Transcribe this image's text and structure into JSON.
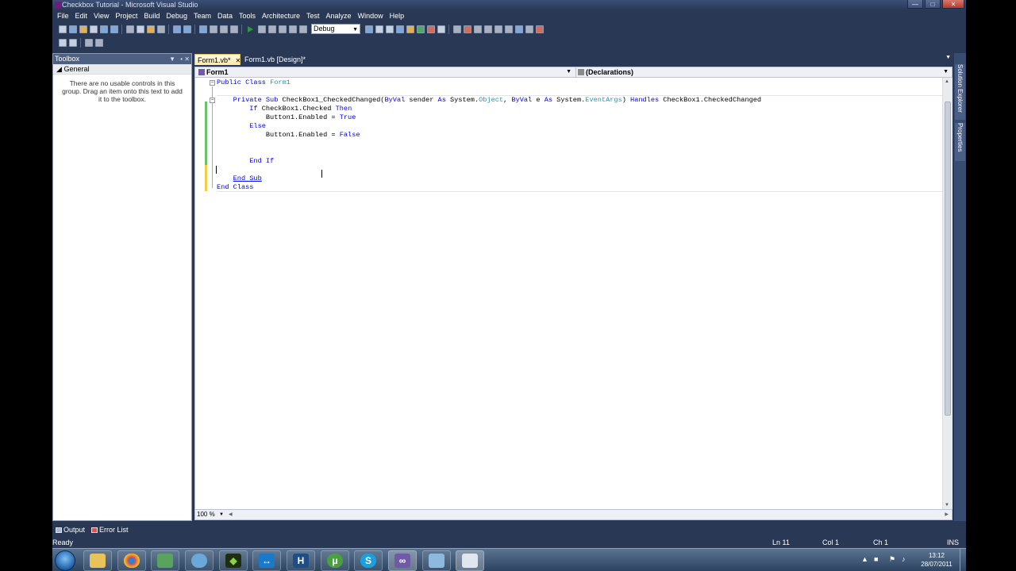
{
  "window": {
    "title": "Checkbox Tutorial - Microsoft Visual Studio"
  },
  "menu": [
    "File",
    "Edit",
    "View",
    "Project",
    "Build",
    "Debug",
    "Team",
    "Data",
    "Tools",
    "Architecture",
    "Test",
    "Analyze",
    "Window",
    "Help"
  ],
  "toolbar": {
    "configuration": "Debug"
  },
  "toolbox": {
    "title": "Toolbox",
    "group": "General",
    "message": "There are no usable controls in this group. Drag an item onto this text to add it to the toolbox."
  },
  "tabs": [
    {
      "label": "Form1.vb*",
      "active": true
    },
    {
      "label": "Form1.vb [Design]*",
      "active": false
    }
  ],
  "navbar": {
    "class_combo": "Form1",
    "member_combo": "(Declarations)"
  },
  "code": {
    "lines": [
      "Public Class Form1",
      "",
      "    Private Sub CheckBox1_CheckedChanged(ByVal sender As System.Object, ByVal e As System.EventArgs) Handles CheckBox1.CheckedChanged",
      "        If CheckBox1.Checked Then",
      "            Button1.Enabled = True",
      "        Else",
      "            Button1.Enabled = False",
      "",
      "",
      "        End If",
      "",
      "    End Sub",
      "End Class"
    ]
  },
  "zoom": "100 %",
  "right_panels": [
    "Solution Explorer",
    "Properties"
  ],
  "bottom_tabs": [
    "Output",
    "Error List"
  ],
  "status": {
    "text": "Ready",
    "ln": "Ln 11",
    "col": "Col 1",
    "ch": "Ch 1",
    "mode": "INS"
  },
  "taskbar": {
    "time": "13:12",
    "date": "28/07/2011"
  },
  "colors": {
    "chrome": "#293955",
    "keyword": "#0000ff",
    "type": "#2b91af",
    "active_tab": "#ffe8a6"
  }
}
